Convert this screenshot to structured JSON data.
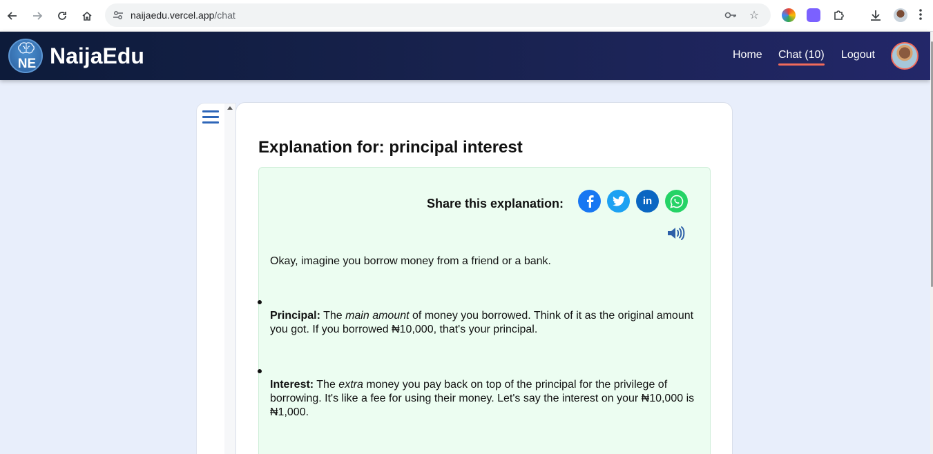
{
  "browser": {
    "url_host": "naijaedu.vercel.app",
    "url_path": "/chat"
  },
  "header": {
    "logo_text": "NE",
    "brand": "NaijaEdu",
    "nav": [
      "Home",
      "Chat (10)",
      "Logout"
    ],
    "active_nav": "Chat (10)",
    "accent_color": "#f26b5b"
  },
  "main": {
    "title": "Explanation for: principal interest",
    "share_label": "Share this explanation:",
    "share_icons": [
      "facebook-icon",
      "twitter-icon",
      "linkedin-icon",
      "whatsapp-icon"
    ],
    "intro": "Okay, imagine you borrow money from a friend or a bank.",
    "items": [
      {
        "term": "Principal:",
        "parts": [
          "The ",
          "main amount",
          " of money you borrowed. Think of it as the original amount you got. If you borrowed ₦10,000, that's your principal."
        ]
      },
      {
        "term": "Interest:",
        "parts": [
          "The ",
          "extra",
          " money you pay back on top of the principal for the privilege of borrowing. It's like a fee for using their money. Let's say the interest on your ₦10,000 is ₦1,000."
        ]
      }
    ]
  }
}
